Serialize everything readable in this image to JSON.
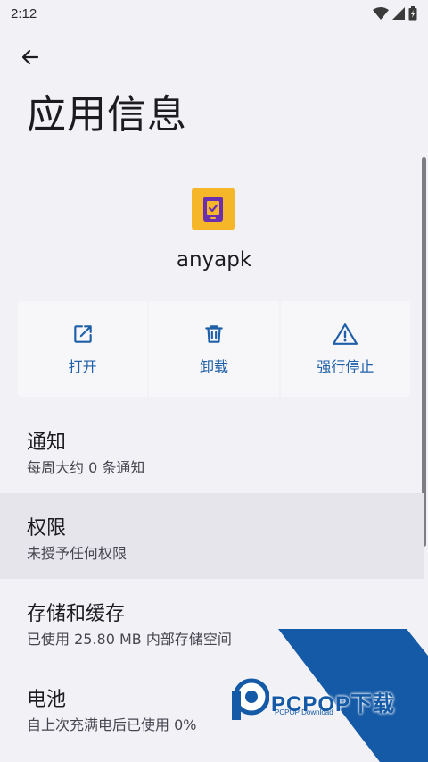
{
  "status_bar": {
    "time": "2:12"
  },
  "header": {
    "title": "应用信息"
  },
  "app": {
    "name": "anyapk",
    "icon": "app-icon"
  },
  "actions": [
    {
      "label": "打开",
      "icon": "open-external-icon"
    },
    {
      "label": "卸载",
      "icon": "trash-icon"
    },
    {
      "label": "强行停止",
      "icon": "warning-icon"
    }
  ],
  "items": [
    {
      "title": "通知",
      "subtitle": "每周大约 0 条通知"
    },
    {
      "title": "权限",
      "subtitle": "未授予任何权限"
    },
    {
      "title": "存储和缓存",
      "subtitle": "已使用 25.80 MB 内部存储空间"
    },
    {
      "title": "电池",
      "subtitle": "自上次充满电后已使用 0%"
    }
  ],
  "watermark": {
    "brand": "PCPOP下载",
    "sub": "PCPOP Download"
  },
  "colors": {
    "accent": "#1f5fa8",
    "background": "#f2f1f6",
    "app_icon": "#f5b62a",
    "watermark": "#155aa6"
  }
}
